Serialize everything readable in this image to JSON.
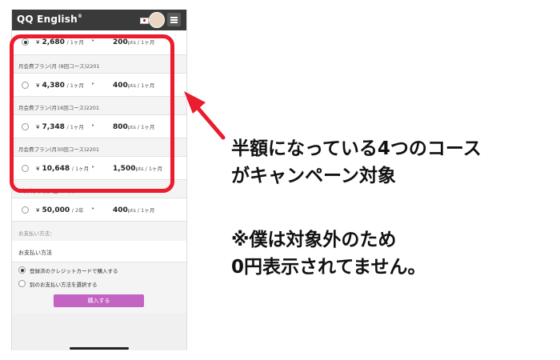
{
  "app": {
    "logo": "QQ English",
    "logo_mark": "®"
  },
  "plans": [
    {
      "selected": true,
      "price": "2,680",
      "price_unit": "/ 1ヶ月",
      "points": "200",
      "points_unit": "pts / 1ヶ月"
    },
    {
      "label": "月会費プラン(月 (8回コース)2201"
    },
    {
      "selected": false,
      "price": "4,380",
      "price_unit": "/ 1ヶ月",
      "points": "400",
      "points_unit": "pts / 1ヶ月"
    },
    {
      "label": "月会費プラン(月16回コース)2201"
    },
    {
      "selected": false,
      "price": "7,348",
      "price_unit": "/ 1ヶ月",
      "points": "800",
      "points_unit": "pts / 1ヶ月"
    },
    {
      "label": "月会費プラン(月30回コース)2201"
    },
    {
      "selected": false,
      "price": "10,648",
      "price_unit": "/ 1ヶ月",
      "points": "1,500",
      "points_unit": "pts / 1ヶ月"
    },
    {
      "label": "2年パック(月8回コース)2201"
    },
    {
      "selected": false,
      "price": "50,000",
      "price_unit": "/ 2年",
      "points": "400",
      "points_unit": "pts / 1ヶ月"
    }
  ],
  "currency": "¥",
  "arrow_glyph": "▸",
  "payment": {
    "section_label": "お支払い方法：",
    "heading": "お支払い方法",
    "options": [
      {
        "label": "登録済のクレジットカードで購入する",
        "selected": true
      },
      {
        "label": "別のお支払い方法を選択する",
        "selected": false
      }
    ],
    "buy_button": "購入する"
  },
  "annotation": {
    "line1": "半額になっている4つのコース",
    "line2": "がキャンペーン対象",
    "line3": "※僕は対象外のため",
    "line4": "0円表示されてません。"
  },
  "colors": {
    "highlight": "#ea1c2d",
    "buy_button": "#c364c4",
    "topbar": "#3a3a3a"
  }
}
